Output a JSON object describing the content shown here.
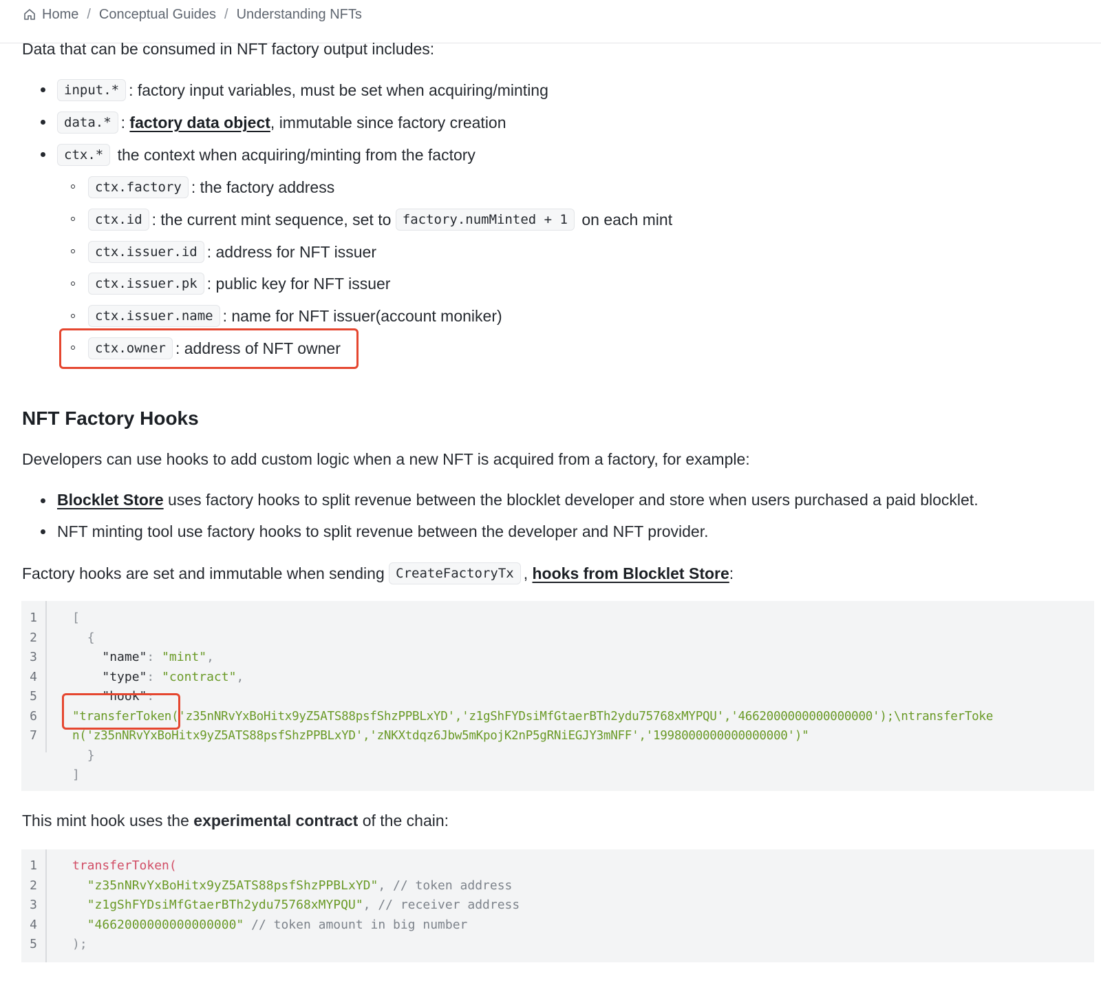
{
  "breadcrumb": {
    "home": "Home",
    "sep": "/",
    "level1": "Conceptual Guides",
    "level2": "Understanding NFTs"
  },
  "intro": "Data that can be consumed in NFT factory output includes:",
  "list1": [
    {
      "code": "input.*",
      "text": ": factory input variables, must be set when acquiring/minting"
    },
    {
      "code": "data.*",
      "sep": ": ",
      "link": "factory data object",
      "text": ", immutable since factory creation"
    },
    {
      "code": "ctx.*",
      "text": " the context when acquiring/minting from the factory"
    }
  ],
  "ctx_list": [
    {
      "code": "ctx.factory",
      "text": ": the factory address"
    },
    {
      "code": "ctx.id",
      "text": ": the current mint sequence, set to ",
      "code2": "factory.numMinted + 1",
      "text2": " on each mint"
    },
    {
      "code": "ctx.issuer.id",
      "text": ": address for NFT issuer"
    },
    {
      "code": "ctx.issuer.pk",
      "text": ": public key for NFT issuer"
    },
    {
      "code": "ctx.issuer.name",
      "text": ": name for NFT issuer(account moniker)"
    },
    {
      "code": "ctx.owner",
      "text": ": address of NFT owner"
    }
  ],
  "hooks": {
    "title": "NFT Factory Hooks",
    "desc": "Developers can use hooks to add custom logic when a new NFT is acquired from a factory, for example:",
    "bullets": [
      {
        "link": "Blocklet Store",
        "text": " uses factory hooks to split revenue between the blocklet developer and store when users purchased a paid blocklet."
      },
      {
        "text": "NFT minting tool use factory hooks to split revenue between the developer and NFT provider."
      }
    ],
    "set_text": "Factory hooks are set and immutable when sending ",
    "set_code": "CreateFactoryTx",
    "set_comma": ", ",
    "set_link": "hooks from Blocklet Store",
    "set_colon": ":"
  },
  "code1": {
    "line_numbers": [
      "1",
      "2",
      "3",
      "4",
      "5",
      "6",
      "7"
    ],
    "lines": {
      "l1": "[",
      "l2": "{",
      "l3_key": "\"name\"",
      "l3_colon": ": ",
      "l3_val": "\"mint\"",
      "l3_comma": ",",
      "l4_key": "\"type\"",
      "l4_colon": ": ",
      "l4_val": "\"contract\"",
      "l4_comma": ",",
      "l5_key": "\"hook\"",
      "l5_colon": ":",
      "l6": "\"transferToken('z35nNRvYxBoHitx9yZ5ATS88psfShzPPBLxYD','z1gShFYDsiMfGtaerBTh2ydu75768xMYPQU','4662000000000000000');\\ntransferToke",
      "l6b": "n('z35nNRvYxBoHitx9yZ5ATS88psfShzPPBLxYD','zNKXtdqz6Jbw5mKpojK2nP5gRNiEGJY3mNFF','1998000000000000000')\"",
      "l7": "}",
      "l8": "]"
    }
  },
  "mint_text": {
    "a": "This mint hook uses the ",
    "b": "experimental contract",
    "c": " of the chain:"
  },
  "code2": {
    "line_numbers": [
      "1",
      "2",
      "3",
      "4",
      "5"
    ],
    "l1": "transferToken(",
    "l2_val": "\"z35nNRvYxBoHitx9yZ5ATS88psfShzPPBLxYD\"",
    "l2_comment": ", // token address",
    "l3_val": "\"z1gShFYDsiMfGtaerBTh2ydu75768xMYPQU\"",
    "l3_comment": ", // receiver address",
    "l4_val": "\"4662000000000000000\"",
    "l4_comment": " // token amount in big number",
    "l5": ");"
  },
  "colors": {
    "highlight": "#e5462f",
    "string": "#6a9a27",
    "function": "#d14d65"
  }
}
